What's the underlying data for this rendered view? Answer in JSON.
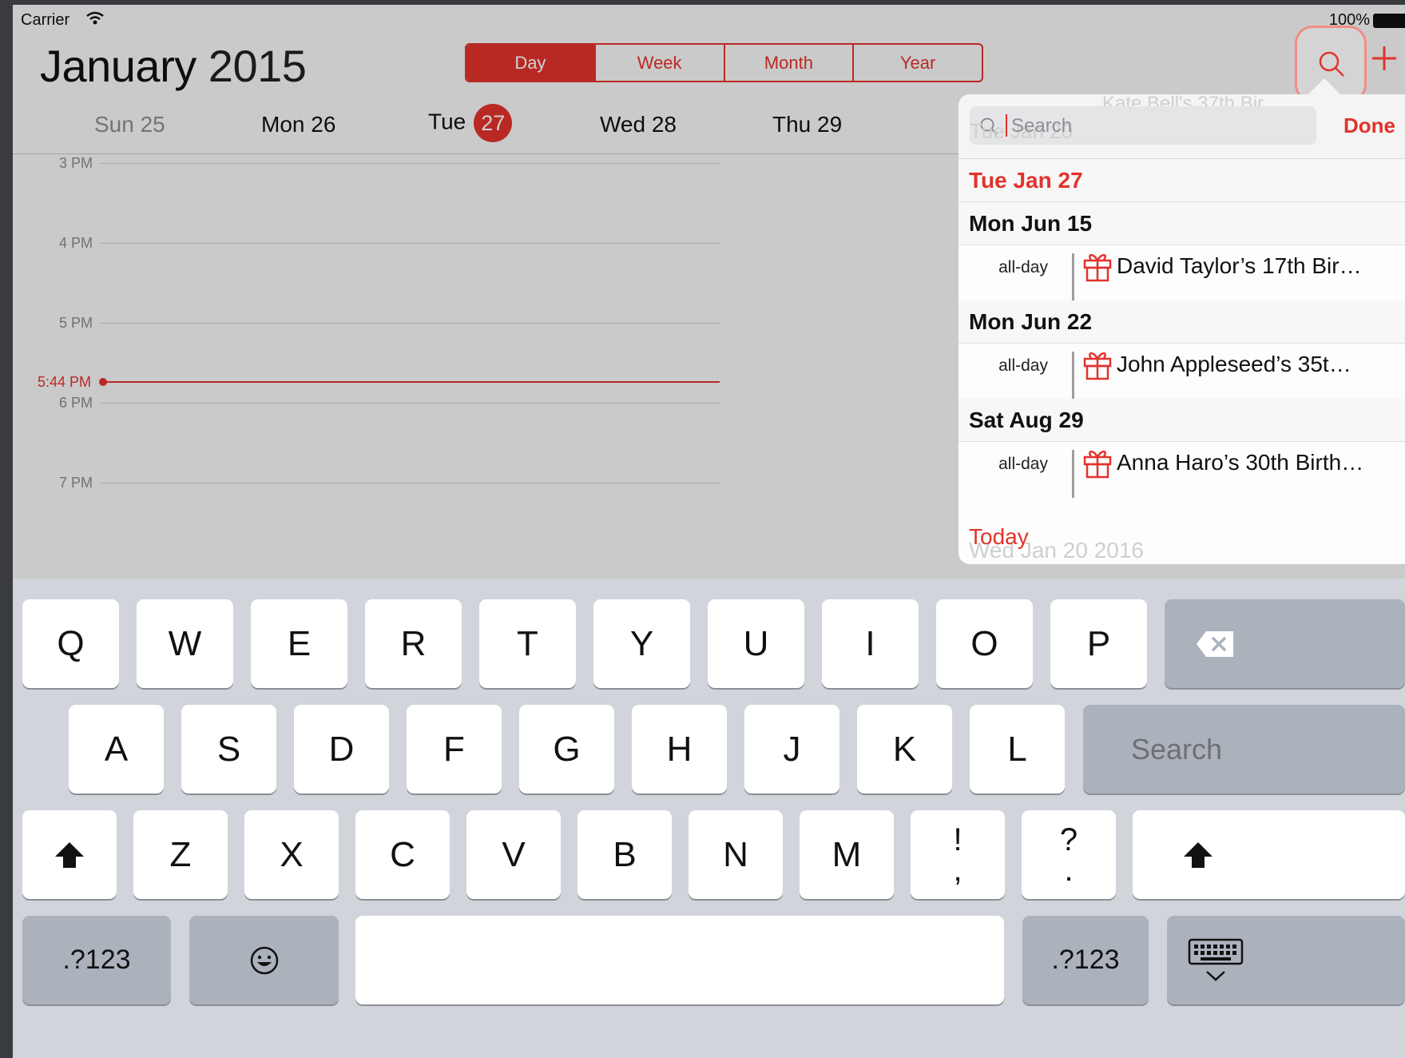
{
  "status_bar": {
    "carrier": "Carrier",
    "battery": "100%"
  },
  "header": {
    "month": "January",
    "year": "2015",
    "view_tabs": [
      "Day",
      "Week",
      "Month",
      "Year"
    ],
    "selected_tab": "Day"
  },
  "day_strip": {
    "days": [
      "Sun 25",
      "Mon 26",
      "Tue",
      "Wed 28",
      "Thu 29"
    ],
    "today_number": "27"
  },
  "timeline": {
    "hours": [
      "3 PM",
      "4 PM",
      "5 PM",
      "6 PM",
      "7 PM"
    ],
    "current_time": "5:44 PM"
  },
  "search_popover": {
    "placeholder": "Search",
    "done": "Done",
    "ghost_texts": [
      "Kate Bell's 37th Bir",
      "Tue Jan 20",
      "Wed Jan 20 2016"
    ],
    "sections": [
      {
        "header": "Tue  Jan 27",
        "highlight": true,
        "events": []
      },
      {
        "header": "Mon  Jun 15",
        "highlight": false,
        "events": [
          {
            "time": "all-day",
            "title": "David Taylor’s 17th Bir…",
            "icon": "gift-icon"
          }
        ]
      },
      {
        "header": "Mon  Jun 22",
        "highlight": false,
        "events": [
          {
            "time": "all-day",
            "title": "John Appleseed’s 35t…",
            "icon": "gift-icon"
          }
        ]
      },
      {
        "header": "Sat  Aug 29",
        "highlight": false,
        "events": [
          {
            "time": "all-day",
            "title": "Anna Haro’s 30th Birth…",
            "icon": "gift-icon"
          }
        ]
      }
    ],
    "today_link": "Today"
  },
  "keyboard": {
    "row1": [
      "Q",
      "W",
      "E",
      "R",
      "T",
      "Y",
      "U",
      "I",
      "O",
      "P"
    ],
    "row2": [
      "A",
      "S",
      "D",
      "F",
      "G",
      "H",
      "J",
      "K",
      "L"
    ],
    "search_key": "Search",
    "row3": [
      "Z",
      "X",
      "C",
      "V",
      "B",
      "N",
      "M"
    ],
    "punct1": {
      "top": "!",
      "bottom": ","
    },
    "punct2": {
      "top": "?",
      "bottom": "."
    },
    "numbers_key": ".?123",
    "icons": [
      "delete-icon",
      "shift-icon",
      "emoji-icon",
      "keyboard-dismiss-icon"
    ]
  },
  "colors": {
    "accent": "#e2332c",
    "key": "#ffffff",
    "key_dark": "#abb2bc",
    "keyboard_bg": "#d1d5db"
  }
}
